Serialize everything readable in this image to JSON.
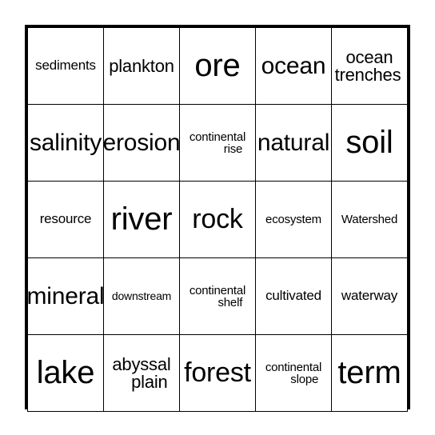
{
  "card": {
    "type": "bingo-card",
    "rows": 5,
    "columns": 5,
    "border_color": "#000000",
    "background_color": "#ffffff",
    "text_color": "#000000",
    "cells": [
      [
        {
          "text": "sediments",
          "lines": [
            "sediments"
          ],
          "size": "xs"
        },
        {
          "text": "plankton",
          "lines": [
            "plankton"
          ],
          "size": "sm"
        },
        {
          "text": "ore",
          "lines": [
            "ore"
          ],
          "size": "xl"
        },
        {
          "text": "ocean",
          "lines": [
            "ocean"
          ],
          "size": "md"
        },
        {
          "text": "ocean trenches",
          "lines": [
            "ocean",
            "trenches"
          ],
          "size": "sm"
        }
      ],
      [
        {
          "text": "salinity",
          "lines": [
            "salinity"
          ],
          "size": "md"
        },
        {
          "text": "erosion",
          "lines": [
            "erosion"
          ],
          "size": "md"
        },
        {
          "text": "continental rise",
          "lines": [
            "continental",
            "rise"
          ],
          "size": "xxs"
        },
        {
          "text": "natural",
          "lines": [
            "natural"
          ],
          "size": "md"
        },
        {
          "text": "soil",
          "lines": [
            "soil"
          ],
          "size": "xl"
        }
      ],
      [
        {
          "text": "resource",
          "lines": [
            "resource"
          ],
          "size": "xs"
        },
        {
          "text": "river",
          "lines": [
            "river"
          ],
          "size": "xl"
        },
        {
          "text": "rock",
          "lines": [
            "rock"
          ],
          "size": "lg"
        },
        {
          "text": "ecosystem",
          "lines": [
            "ecosystem"
          ],
          "size": "xxs"
        },
        {
          "text": "Watershed",
          "lines": [
            "Watershed"
          ],
          "size": "xxs"
        }
      ],
      [
        {
          "text": "mineral",
          "lines": [
            "mineral"
          ],
          "size": "md"
        },
        {
          "text": "downstream",
          "lines": [
            "downstream"
          ],
          "size": "tiny"
        },
        {
          "text": "continental shelf",
          "lines": [
            "continental",
            "shelf"
          ],
          "size": "xxs"
        },
        {
          "text": "cultivated",
          "lines": [
            "cultivated"
          ],
          "size": "xs"
        },
        {
          "text": "waterway",
          "lines": [
            "waterway"
          ],
          "size": "xs"
        }
      ],
      [
        {
          "text": "lake",
          "lines": [
            "lake"
          ],
          "size": "xl"
        },
        {
          "text": "abyssal plain",
          "lines": [
            "abyssal",
            "plain"
          ],
          "size": "sm"
        },
        {
          "text": "forest",
          "lines": [
            "forest"
          ],
          "size": "lg"
        },
        {
          "text": "continental slope",
          "lines": [
            "continental",
            "slope"
          ],
          "size": "xxs"
        },
        {
          "text": "term",
          "lines": [
            "term"
          ],
          "size": "xl"
        }
      ]
    ]
  }
}
